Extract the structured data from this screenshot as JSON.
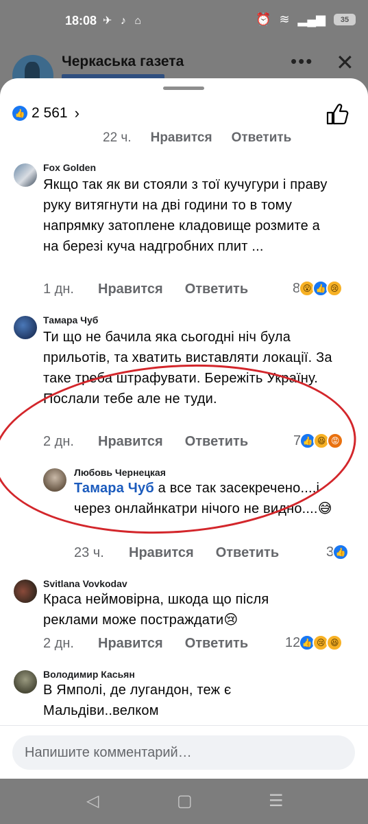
{
  "status": {
    "time": "18:08",
    "left_icons": "✈ ♪ ⌂",
    "battery": "35"
  },
  "background": {
    "page_title": "Черкаська газета",
    "more": "•••",
    "close": "✕"
  },
  "header": {
    "like_count": "2 561",
    "like_icon": "like-icon"
  },
  "partial_row": {
    "time": "22 ч.",
    "like": "Нравится",
    "reply": "Ответить"
  },
  "comments": [
    {
      "author": "Fox Golden",
      "text": "Якщо  так як ви стояли  з тої кучугури і праву руку витягнути на дві години то в тому напрямку затоплене кладовище розмите а на березі куча надгробних плит ...",
      "time": "1 дн.",
      "like": "Нравится",
      "reply": "Ответить",
      "reaction_count": "8",
      "reactions": [
        "wow",
        "like",
        "sad"
      ]
    },
    {
      "author": "Тамара Чуб",
      "text": "Ти що не бачила яка сьогодні ніч була прильотів, та хватить виставляти локації. За таке треба штрафувати. Бережіть Україну. Послали тебе але не туди.",
      "time": "2 дн.",
      "like": "Нравится",
      "reply": "Ответить",
      "reaction_count": "7",
      "reactions": [
        "like",
        "haha",
        "angry"
      ]
    },
    {
      "author": "Любовь Чернецкая",
      "mention": "Тамара Чуб",
      "text": " а все так засекречено....і через онлайнкатри нічого не видно....😅",
      "time": "23 ч.",
      "like": "Нравится",
      "reply": "Ответить",
      "reaction_count": "3",
      "reactions": [
        "like"
      ]
    },
    {
      "author": "Svitlana Vovkodav",
      "text": "Краса неймовірна, шкода що після реклами може постраждати😢",
      "time": "2 дн.",
      "like": "Нравится",
      "reply": "Ответить",
      "reaction_count": "12",
      "reactions": [
        "like",
        "sad",
        "haha"
      ]
    },
    {
      "author": "Володимир Касьян",
      "text": "В Ямполі, де лугандон, теж є Мальдіви..велком"
    }
  ],
  "composer": {
    "placeholder": "Напишите комментарий…"
  },
  "nav": {
    "back": "◁",
    "home": "▢",
    "menu": "☰"
  },
  "colors": {
    "accent": "#1877f2",
    "annotation": "#d3262b"
  }
}
